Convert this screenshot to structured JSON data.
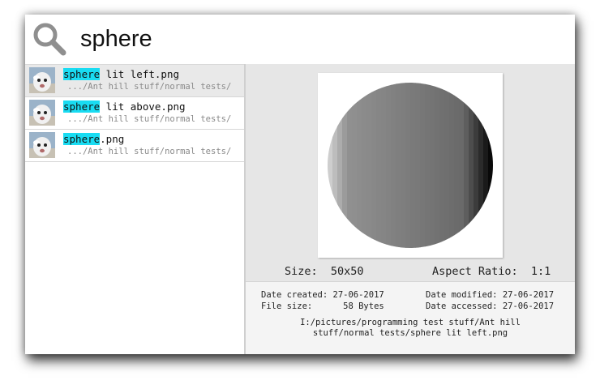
{
  "search": {
    "query": "sphere"
  },
  "results": [
    {
      "match": "sphere",
      "rest": " lit left.png",
      "path": ".../Ant hill stuff/normal tests/"
    },
    {
      "match": "sphere",
      "rest": " lit above.png",
      "path": ".../Ant hill stuff/normal tests/"
    },
    {
      "match": "sphere",
      "rest": ".png",
      "path": ".../Ant hill stuff/normal tests/"
    }
  ],
  "preview": {
    "size_text": "Size:  50x50",
    "aspect_text": "Aspect Ratio:  1:1",
    "date_created": "Date created: 27-06-2017",
    "file_size": "File size:      58 Bytes",
    "date_modified": "Date modified: 27-06-2017",
    "date_accessed": "Date accessed: 27-06-2017",
    "path_line1": "I:/pictures/programming test stuff/Ant hill",
    "path_line2": "stuff/normal tests/sphere lit left.png"
  },
  "colors": {
    "highlight": "#19dcf2",
    "selected_row": "#e9e9e9",
    "preview_bg": "#e6e6e6"
  }
}
